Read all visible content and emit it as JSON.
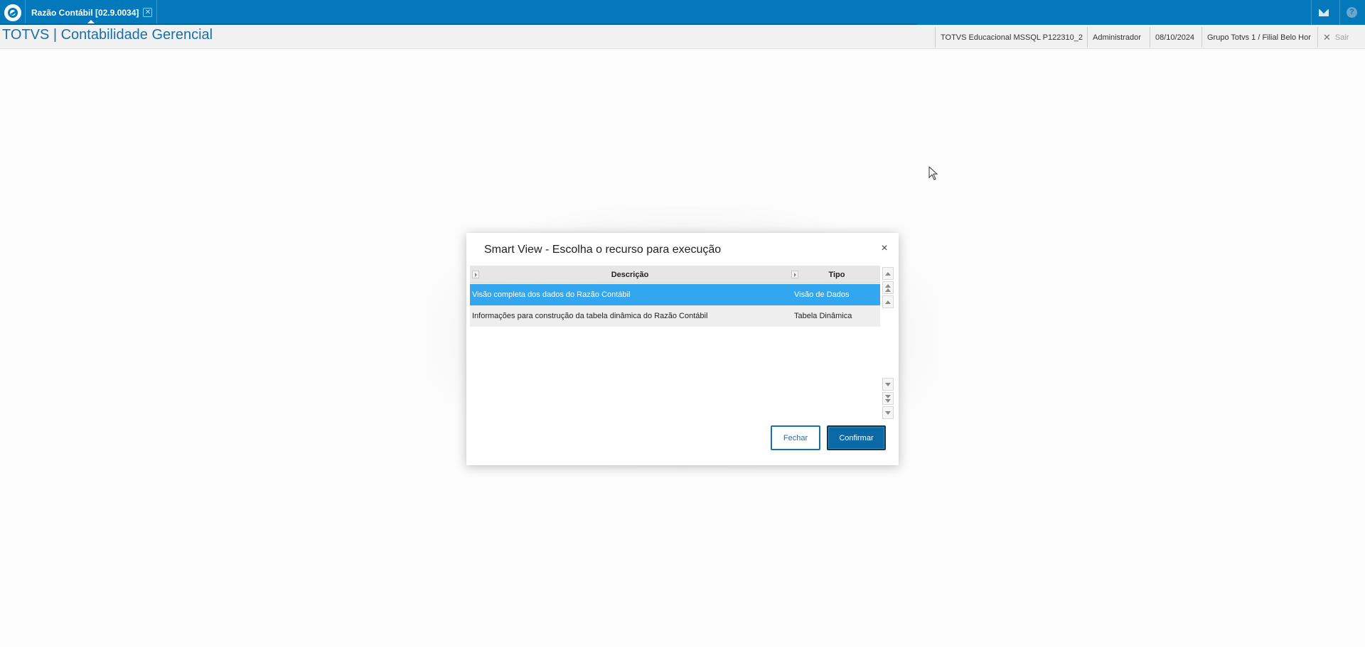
{
  "topbar": {
    "tab_label": "Razão Contábil [02.9.0034]",
    "tab_close_glyph": "✕",
    "icons": [
      "totvs-logo-icon",
      "mail-icon",
      "help-icon"
    ],
    "help_glyph": "?"
  },
  "subbar": {
    "app_title": "TOTVS | Contabilidade Gerencial",
    "environment": "TOTVS Educacional MSSQL P122310_2",
    "user": "Administrador",
    "date": "08/10/2024",
    "branch": "Grupo Totvs 1 / Filial Belo Hor",
    "exit_glyph": "✕",
    "exit_label": "Sair"
  },
  "modal": {
    "title": "Smart View - Escolha o recurso para execução",
    "close_glyph": "×",
    "columns": [
      "Descrição",
      "Tipo"
    ],
    "rows": [
      {
        "description": "Visão completa dos dados do Razão Contábil",
        "type": "Visão de Dados"
      },
      {
        "description": "Informações para construção da tabela dinâmica do Razão Contábil",
        "type": "Tabela Dinâmica"
      }
    ],
    "selected_row": 0,
    "buttons": {
      "close": "Fechar",
      "confirm": "Confirmar"
    }
  },
  "colors": {
    "topbar": "#0379bb",
    "selected_row": "#33a6f0",
    "confirm_button": "#0b6aa6",
    "title_text": "#1a6fa6"
  }
}
